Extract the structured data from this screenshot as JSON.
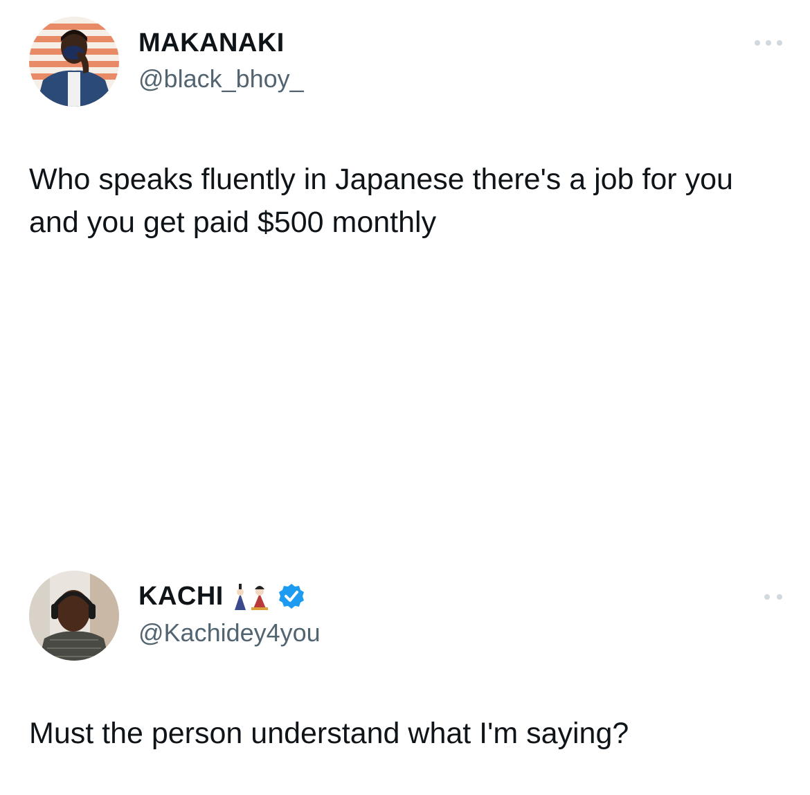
{
  "tweets": [
    {
      "author_name": "MAKANAKI",
      "author_handle": "@black_bhoy_",
      "text": "Who speaks fluently in Japanese there's a job for you and you get paid $500 monthly",
      "avatar_icon": "profile-photo-man-in-suit-striped-background",
      "more_icon": "more-options-icon"
    },
    {
      "author_name": "KACHI",
      "name_emoji_icon": "japanese-dolls-emoji",
      "verified_icon": "verified-badge-icon",
      "author_handle": "@Kachidey4you",
      "text": "Must the person understand what I'm saying?",
      "avatar_icon": "profile-photo-man-with-headphones",
      "more_icon": "more-options-icon"
    }
  ],
  "colors": {
    "text_primary": "#0f1419",
    "text_secondary": "#536471",
    "verified_blue": "#1d9bf0",
    "dots": "#cfd9de"
  }
}
